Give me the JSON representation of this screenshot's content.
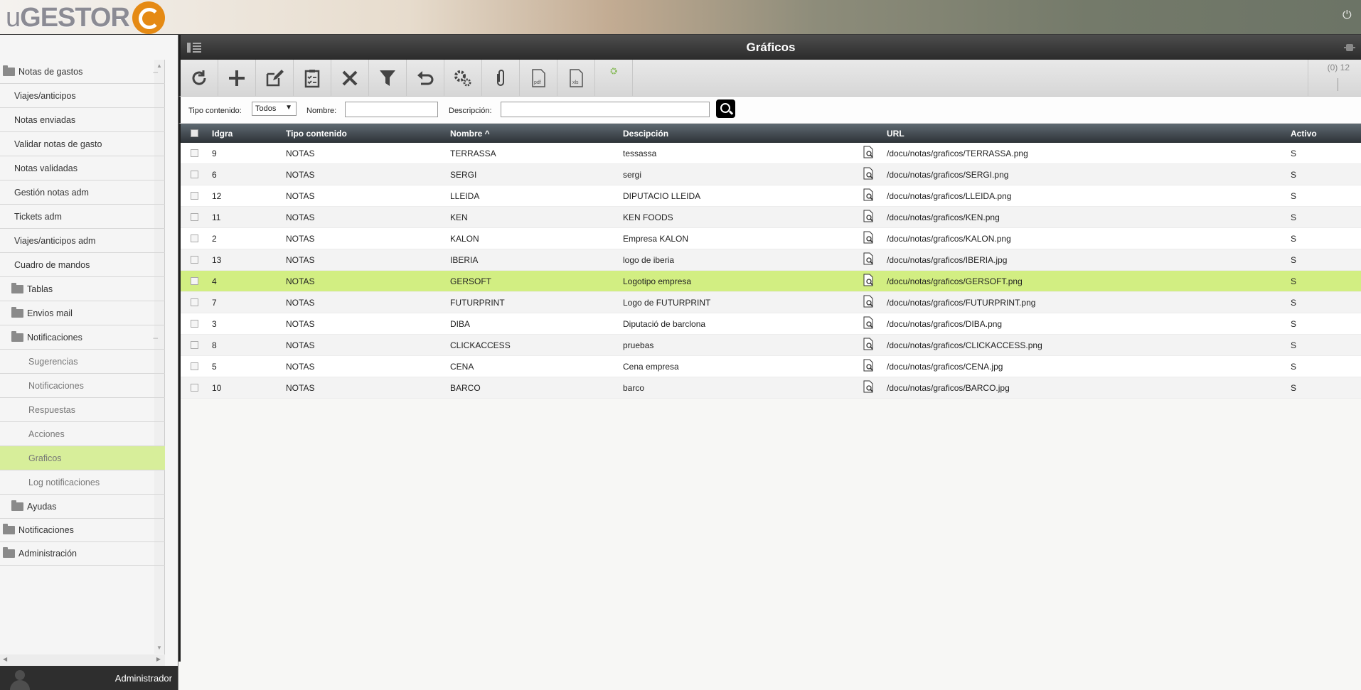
{
  "app": {
    "logo_text_u": "u",
    "logo_text_main": "GESTOR",
    "user_name": "Administrador"
  },
  "sidebar": {
    "items": [
      {
        "label": "Notas de gastos",
        "type": "group",
        "icon": "folder-icon",
        "collapse": "–"
      },
      {
        "label": "Viajes/anticipos",
        "type": "l1"
      },
      {
        "label": "Notas enviadas",
        "type": "l1"
      },
      {
        "label": "Validar notas de gasto",
        "type": "l1"
      },
      {
        "label": "Notas validadas",
        "type": "l1"
      },
      {
        "label": "Gestión notas adm",
        "type": "l1"
      },
      {
        "label": "Tickets adm",
        "type": "l1"
      },
      {
        "label": "Viajes/anticipos adm",
        "type": "l1"
      },
      {
        "label": "Cuadro de mandos",
        "type": "l1"
      },
      {
        "label": "Tablas",
        "type": "sub-group",
        "icon": "folder-icon"
      },
      {
        "label": "Envios mail",
        "type": "sub-group",
        "icon": "folder-icon"
      },
      {
        "label": "Notificaciones",
        "type": "sub-group",
        "icon": "folder-icon",
        "collapse": "–"
      },
      {
        "label": "Sugerencias",
        "type": "l2"
      },
      {
        "label": "Notificaciones",
        "type": "l2"
      },
      {
        "label": "Respuestas",
        "type": "l2"
      },
      {
        "label": "Acciones",
        "type": "l2"
      },
      {
        "label": "Graficos",
        "type": "l2",
        "active": true
      },
      {
        "label": "Log notificaciones",
        "type": "l2"
      },
      {
        "label": "Ayudas",
        "type": "sub-group",
        "icon": "folder-icon"
      },
      {
        "label": "Notificaciones",
        "type": "group",
        "icon": "folder-icon"
      },
      {
        "label": "Administración",
        "type": "group",
        "icon": "folder-icon"
      }
    ]
  },
  "page": {
    "title": "Gráficos",
    "counter": "(0) 12"
  },
  "toolbar": {
    "buttons": [
      "refresh-icon",
      "add-icon",
      "edit-icon",
      "clipboard-check-icon",
      "delete-icon",
      "filter-icon",
      "undo-icon",
      "gears-icon",
      "attachment-icon",
      "pdf-icon",
      "xls-icon",
      "config-icon"
    ]
  },
  "filters": {
    "tipo_label": "Tipo contenido:",
    "tipo_value": "Todos",
    "nombre_label": "Nombre:",
    "nombre_value": "",
    "descripcion_label": "Descripción:",
    "descripcion_value": ""
  },
  "table": {
    "columns": {
      "idgra": "Idgra",
      "tipo": "Tipo contenido",
      "nombre": "Nombre ^",
      "descripcion": "Descipción",
      "url": "URL",
      "activo": "Activo"
    },
    "rows": [
      {
        "idgra": "9",
        "tipo": "NOTAS",
        "nombre": "TERRASSA",
        "descripcion": "tessassa",
        "url": "/docu/notas/graficos/TERRASSA.png",
        "activo": "S"
      },
      {
        "idgra": "6",
        "tipo": "NOTAS",
        "nombre": "SERGI",
        "descripcion": "sergi",
        "url": "/docu/notas/graficos/SERGI.png",
        "activo": "S"
      },
      {
        "idgra": "12",
        "tipo": "NOTAS",
        "nombre": "LLEIDA",
        "descripcion": "DIPUTACIO LLEIDA",
        "url": "/docu/notas/graficos/LLEIDA.png",
        "activo": "S"
      },
      {
        "idgra": "11",
        "tipo": "NOTAS",
        "nombre": "KEN",
        "descripcion": "KEN FOODS",
        "url": "/docu/notas/graficos/KEN.png",
        "activo": "S"
      },
      {
        "idgra": "2",
        "tipo": "NOTAS",
        "nombre": "KALON",
        "descripcion": "Empresa KALON",
        "url": "/docu/notas/graficos/KALON.png",
        "activo": "S"
      },
      {
        "idgra": "13",
        "tipo": "NOTAS",
        "nombre": "IBERIA",
        "descripcion": "logo de iberia",
        "url": "/docu/notas/graficos/IBERIA.jpg",
        "activo": "S"
      },
      {
        "idgra": "4",
        "tipo": "NOTAS",
        "nombre": "GERSOFT",
        "descripcion": "Logotipo empresa",
        "url": "/docu/notas/graficos/GERSOFT.png",
        "activo": "S",
        "selected": true
      },
      {
        "idgra": "7",
        "tipo": "NOTAS",
        "nombre": "FUTURPRINT",
        "descripcion": "Logo de FUTURPRINT",
        "url": "/docu/notas/graficos/FUTURPRINT.png",
        "activo": "S"
      },
      {
        "idgra": "3",
        "tipo": "NOTAS",
        "nombre": "DIBA",
        "descripcion": "Diputació de barclona",
        "url": "/docu/notas/graficos/DIBA.png",
        "activo": "S"
      },
      {
        "idgra": "8",
        "tipo": "NOTAS",
        "nombre": "CLICKACCESS",
        "descripcion": "pruebas",
        "url": "/docu/notas/graficos/CLICKACCESS.png",
        "activo": "S"
      },
      {
        "idgra": "5",
        "tipo": "NOTAS",
        "nombre": "CENA",
        "descripcion": "Cena empresa",
        "url": "/docu/notas/graficos/CENA.jpg",
        "activo": "S"
      },
      {
        "idgra": "10",
        "tipo": "NOTAS",
        "nombre": "BARCO",
        "descripcion": "barco",
        "url": "/docu/notas/graficos/BARCO.jpg",
        "activo": "S"
      }
    ]
  },
  "colors": {
    "accent_logo": "#e58a14",
    "selected_row": "#d2ee82",
    "active_menu": "#d7ee9a",
    "header_dark": "#2b2b2b"
  }
}
